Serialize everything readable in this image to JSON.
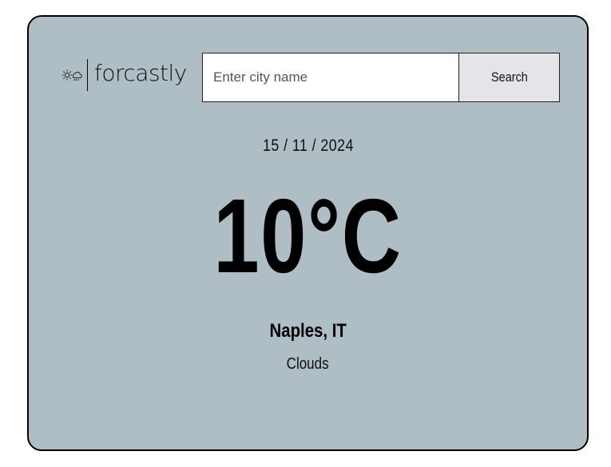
{
  "app": {
    "name": "forcastly",
    "logo_icon": "sun-cloud-rain-icon"
  },
  "search": {
    "placeholder": "Enter city name",
    "value": "",
    "button_label": "Search"
  },
  "weather": {
    "date": "15 / 11 / 2024",
    "temperature": "10°C",
    "location": "Naples, IT",
    "condition": "Clouds"
  },
  "colors": {
    "card_background": "#afbdc4",
    "button_background": "#e7e4e9",
    "text": "#000000"
  }
}
